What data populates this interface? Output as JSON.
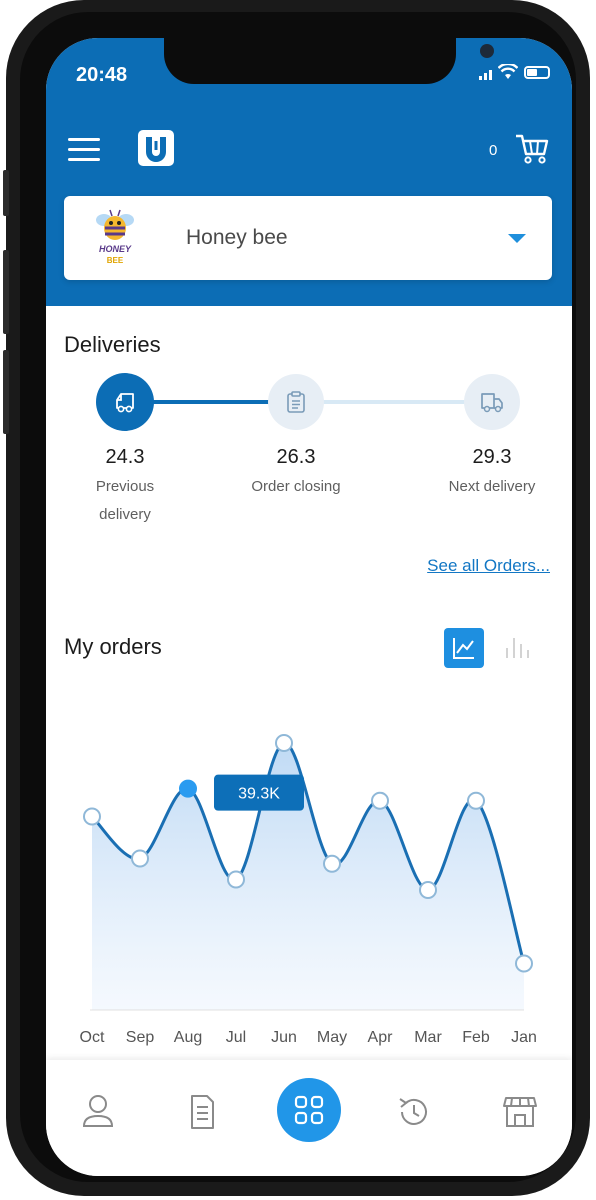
{
  "status_bar": {
    "time": "20:48"
  },
  "header": {
    "cart_count": "0"
  },
  "store": {
    "name": "Honey bee",
    "logo_text_top": "HONEY",
    "logo_text_bottom": "BEE"
  },
  "deliveries": {
    "title": "Deliveries",
    "steps": [
      {
        "date": "24.3",
        "label_line1": "Previous",
        "label_line2": "delivery",
        "icon": "truck-icon",
        "active": true
      },
      {
        "date": "26.3",
        "label_line1": "Order closing",
        "label_line2": "",
        "icon": "clipboard-icon",
        "active": false
      },
      {
        "date": "29.3",
        "label_line1": "Next delivery",
        "label_line2": "",
        "icon": "truck-icon",
        "active": false
      }
    ],
    "see_all": "See all Orders..."
  },
  "orders": {
    "title": "My orders",
    "view_toggle": {
      "selected": "line-chart",
      "options": [
        "line-chart",
        "bar-chart"
      ]
    }
  },
  "chart_data": {
    "type": "area",
    "categories": [
      "Oct",
      "Sep",
      "Aug",
      "Jul",
      "Jun",
      "May",
      "Apr",
      "Mar",
      "Feb",
      "Jan"
    ],
    "values": [
      34,
      26,
      39.3,
      22,
      48,
      25,
      37,
      20,
      37,
      6
    ],
    "tooltip": {
      "category": "Aug",
      "label": "39.3K"
    },
    "ylim": [
      0,
      48
    ],
    "grid": false,
    "line_color": "#1a6fb3",
    "fill_color": "#cfe3f8"
  },
  "bottom_nav": {
    "items": [
      "profile-icon",
      "document-icon",
      "apps-grid-icon",
      "history-icon",
      "store-icon"
    ],
    "selected": "apps-grid-icon"
  },
  "colors": {
    "brand": "#0c6db5",
    "accent": "#1e8fe0"
  }
}
